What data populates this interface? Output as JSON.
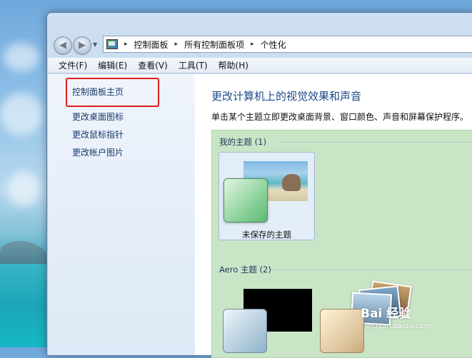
{
  "address_bar": {
    "icon": "control-panel-icon",
    "crumbs": [
      "控制面板",
      "所有控制面板项",
      "个性化"
    ],
    "separator": "▸"
  },
  "menu": {
    "items": [
      "文件(F)",
      "编辑(E)",
      "查看(V)",
      "工具(T)",
      "帮助(H)"
    ]
  },
  "sidebar": {
    "links": [
      "控制面板主页",
      "更改桌面图标",
      "更改鼠标指针",
      "更改帐户图片"
    ],
    "highlight_color": "#e21b1b"
  },
  "main": {
    "title": "更改计算机上的视觉效果和声音",
    "description": "单击某个主题立即更改桌面背景、窗口颜色、声音和屏幕保护程序。",
    "my_themes_label": "我的主题 (1)",
    "unsaved_theme_label": "未保存的主题",
    "aero_themes_label": "Aero 主题 (2)"
  },
  "watermark": {
    "logo_text": "Bai 经验",
    "url": "jingyan.baidu.com"
  },
  "colors": {
    "title": "#1c4a87",
    "link": "#1a3a6b",
    "theme_panel": "#c9e5c6"
  }
}
